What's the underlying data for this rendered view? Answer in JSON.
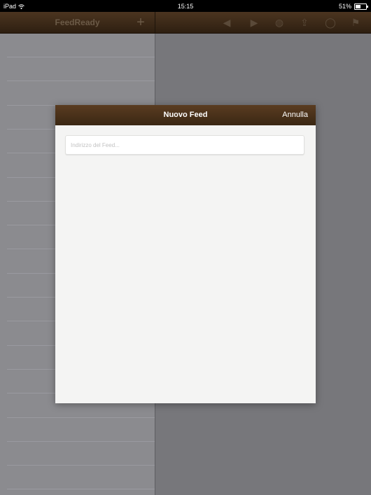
{
  "status_bar": {
    "device": "iPad",
    "wifi_icon": "wifi-icon",
    "time": "15:15",
    "battery_text": "51%",
    "battery_level_percent": 51
  },
  "nav": {
    "title": "FeedReady",
    "add_icon": "+",
    "toolbar_icons": [
      "◀",
      "▶",
      "◍",
      "⇪",
      "◯",
      "⚑"
    ]
  },
  "modal": {
    "title": "Nuovo Feed",
    "cancel_label": "Annulla",
    "input_value": "",
    "input_placeholder": "Indirizzo del Feed..."
  },
  "colors": {
    "nav_brown": "#3a2713",
    "modal_header_brown": "#4a321a",
    "sidebar_gray": "#8b8b8f",
    "content_gray": "#77777b",
    "modal_body": "#f4f4f3"
  }
}
